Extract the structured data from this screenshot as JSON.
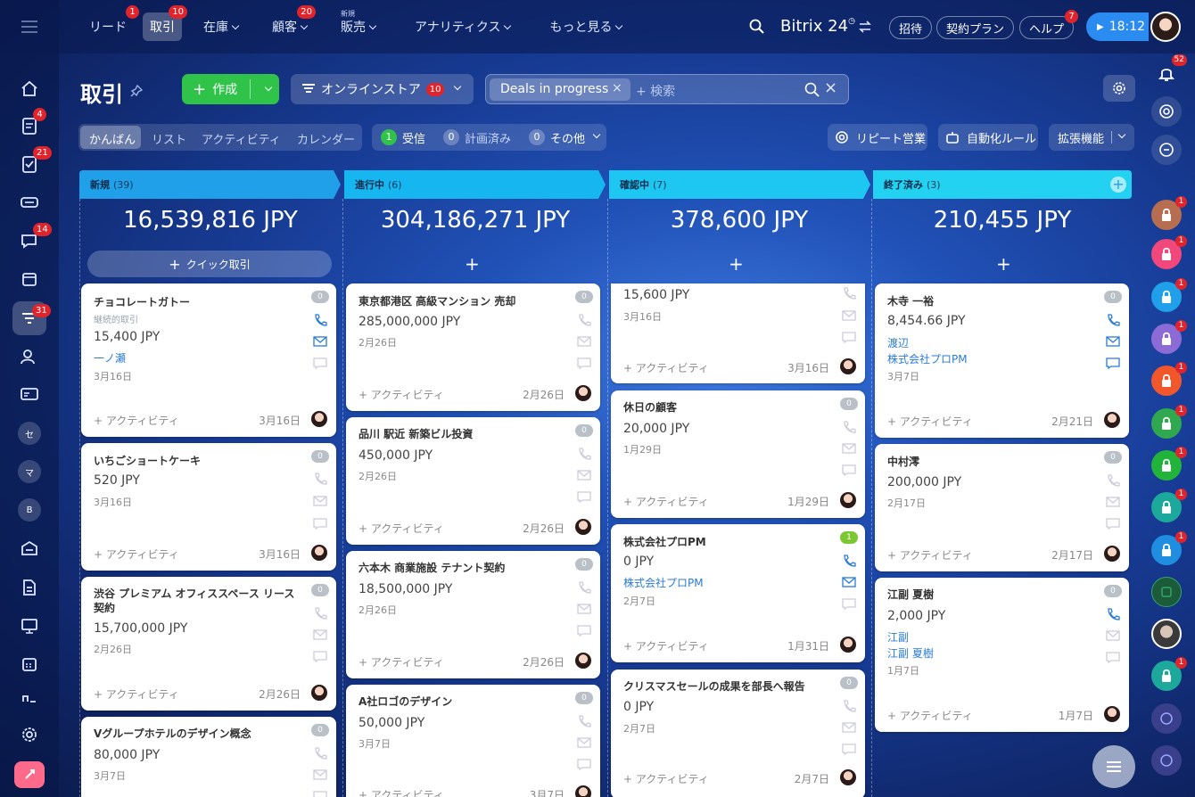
{
  "topnav": {
    "items": [
      {
        "label": "リード",
        "badge": "1"
      },
      {
        "label": "取引",
        "badge": "10",
        "active": true
      },
      {
        "label": "在庫",
        "chev": true
      },
      {
        "label": "顧客",
        "badge": "20",
        "chev": true
      },
      {
        "label": "販売",
        "sup": "新規",
        "chev": true
      },
      {
        "label": "アナリティクス",
        "chev": true
      },
      {
        "label": "もっと見る",
        "chev": true
      }
    ],
    "brand": "Bitrix 24",
    "invite": "招待",
    "plan": "契約プラン",
    "help": "ヘルプ",
    "help_badge": "7",
    "time": "18:12"
  },
  "leftbar": {
    "badges": {
      "tasks": "4",
      "check": "21",
      "chat": "14",
      "crm": "31"
    },
    "circles": [
      "セ",
      "マ",
      "B"
    ]
  },
  "rightbar": {
    "bell_badge": "52",
    "lock_badge": "1"
  },
  "page": {
    "title": "取引"
  },
  "toolbar": {
    "create": "作成",
    "store": "オンラインストア",
    "store_badge": "10",
    "filter_tag": "Deals in progress",
    "search_placeholder": "+ 検索"
  },
  "views": {
    "tabs": [
      "かんばん",
      "リスト",
      "アクティビティ",
      "カレンダー"
    ]
  },
  "counters": {
    "received_count": "1",
    "received": "受信",
    "planned_count": "0",
    "planned": "計画済み",
    "other_count": "0",
    "other": "その他"
  },
  "actions": {
    "repeat": "リピート営業",
    "automation": "自動化ルール",
    "extensions": "拡張機能"
  },
  "columns": [
    {
      "name": "新規",
      "count": "(39)",
      "color": "#1fa0e8",
      "sum": "16,539,816 JPY",
      "quick": "クイック取引",
      "cards": [
        {
          "title": "チョコレートガトー",
          "sub": "継続的取引",
          "amount": "15,400 JPY",
          "link": "一ノ瀬",
          "date": "3月16日",
          "activity": "+ アクティビティ",
          "adate": "3月16日",
          "count": "0"
        },
        {
          "title": "いちごショートケーキ",
          "amount": "520 JPY",
          "date": "3月16日",
          "activity": "+ アクティビティ",
          "adate": "3月16日",
          "count": "0"
        },
        {
          "title": "渋谷 プレミアム オフィススペース リース",
          "title2": "契約",
          "amount": "15,700,000 JPY",
          "date": "2月26日",
          "activity": "+ アクティビティ",
          "adate": "2月26日",
          "count": "0"
        },
        {
          "title": "Vグループホテルのデザイン概念",
          "amount": "80,000 JPY",
          "date": "3月7日",
          "count": "0"
        }
      ]
    },
    {
      "name": "進行中",
      "count": "(6)",
      "color": "#16b6f0",
      "sum": "304,186,271 JPY",
      "cards": [
        {
          "title": "東京都港区 高級マンション 売却",
          "amount": "285,000,000 JPY",
          "date": "2月26日",
          "activity": "+ アクティビティ",
          "adate": "2月26日",
          "count": "0"
        },
        {
          "title": "品川 駅近 新築ビル投資",
          "amount": "450,000 JPY",
          "date": "2月26日",
          "activity": "+ アクティビティ",
          "adate": "2月26日",
          "count": "0"
        },
        {
          "title": "六本木 商業施設 テナント契約",
          "amount": "18,500,000 JPY",
          "date": "2月26日",
          "activity": "+ アクティビティ",
          "adate": "2月26日",
          "count": "0"
        },
        {
          "title": "A社ロゴのデザイン",
          "amount": "50,000 JPY",
          "date": "3月7日",
          "activity": "+ アクティビティ",
          "adate": "3月7日",
          "count": "0"
        }
      ]
    },
    {
      "name": "確認中",
      "count": "(7)",
      "color": "#1ec6f2",
      "sum": "378,600 JPY",
      "cards": [
        {
          "amount": "15,600 JPY",
          "date": "3月16日",
          "activity": "+ アクティビティ",
          "adate": "3月16日"
        },
        {
          "title": "休日の顧客",
          "amount": "20,000 JPY",
          "date": "1月29日",
          "activity": "+ アクティビティ",
          "adate": "1月29日",
          "count": "0"
        },
        {
          "title": "株式会社プロPM",
          "amount": "0 JPY",
          "link": "株式会社プロPM",
          "date": "2月7日",
          "activity": "+ アクティビティ",
          "adate": "1月31日",
          "count": "1"
        },
        {
          "title": "クリスマスセールの成果を部長へ報告",
          "amount": "0 JPY",
          "date": "2月7日",
          "activity": "+ アクティビティ",
          "adate": "2月7日",
          "count": "0"
        }
      ]
    },
    {
      "name": "終了済み",
      "count": "(3)",
      "color": "#22d2f0",
      "sum": "210,455 JPY",
      "cards": [
        {
          "title": "木寺 一裕",
          "amount": "8,454.66 JPY",
          "link": "渡辺",
          "link2": "株式会社プロPM",
          "date": "3月7日",
          "activity": "+ アクティビティ",
          "adate": "2月21日",
          "count": "0"
        },
        {
          "title": "中村澪",
          "amount": "200,000 JPY",
          "date": "2月17日",
          "activity": "+ アクティビティ",
          "adate": "2月17日",
          "count": "0"
        },
        {
          "title": "江副 夏樹",
          "amount": "2,000 JPY",
          "link": "江副",
          "link2": "江副 夏樹",
          "date": "1月7日",
          "activity": "+ アクティビティ",
          "adate": "1月7日",
          "count": "0"
        }
      ]
    }
  ],
  "colors": {
    "accent_green": "#2fc34a",
    "blue_link": "#2a7bd8",
    "badge_red": "#e0242c"
  }
}
